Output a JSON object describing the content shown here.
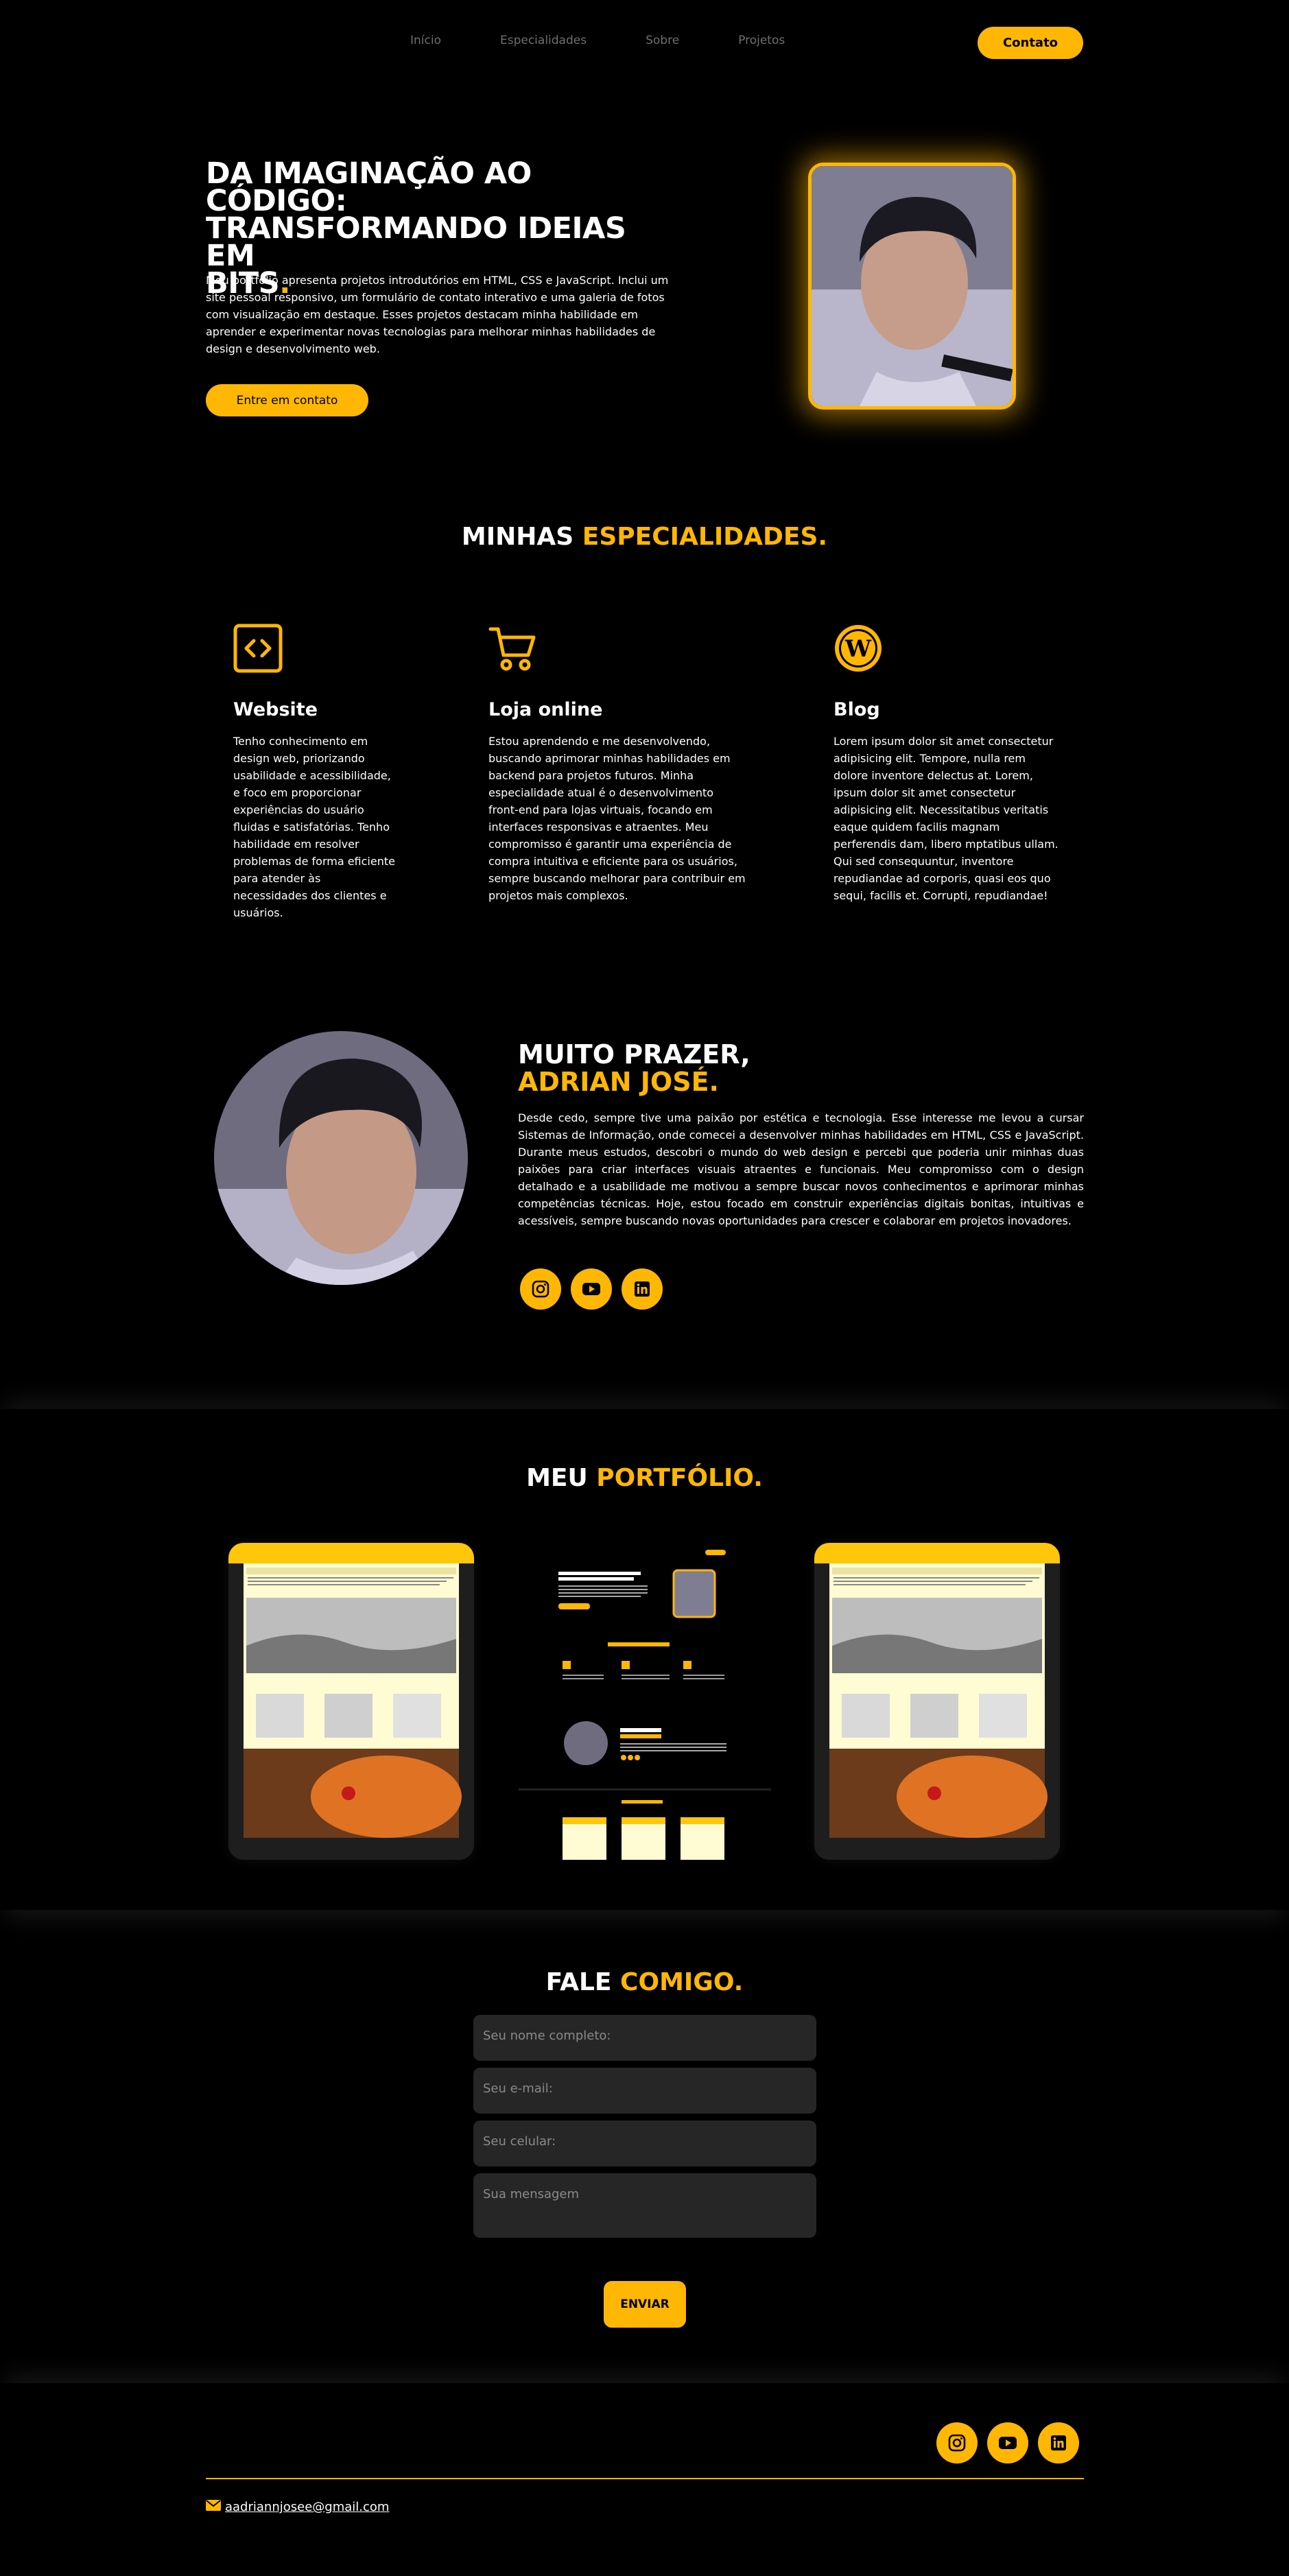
{
  "nav": {
    "links": [
      "Início",
      "Especialidades",
      "Sobre",
      "Projetos"
    ],
    "contact_button": "Contato"
  },
  "hero": {
    "title_line1": "DA IMAGINAÇÃO AO CÓDIGO:",
    "title_line2": "TRANSFORMANDO IDEIAS EM",
    "title_line3": "BITS",
    "title_dot": ".",
    "text": "Meu portfólio apresenta projetos introdutórios em HTML, CSS e JavaScript. Inclui um site pessoal responsivo, um formulário de contato interativo e uma galeria de fotos com visualização em destaque. Esses projetos destacam minha habilidade em aprender e experimentar novas tecnologias para melhorar minhas habilidades de design e desenvolvimento web.",
    "button": "Entre em contato"
  },
  "specialties": {
    "title_white": "MINHAS ",
    "title_yellow": "ESPECIALIDADES.",
    "cards": [
      {
        "icon": "code-icon",
        "title": "Website",
        "text": "Tenho conhecimento em design web, priorizando usabilidade e acessibilidade, e foco em proporcionar experiências do usuário fluidas e satisfatórias. Tenho habilidade em resolver problemas de forma eficiente para atender às necessidades dos clientes e usuários."
      },
      {
        "icon": "shopping-cart-icon",
        "title": "Loja online",
        "text": "Estou aprendendo e me desenvolvendo, buscando aprimorar minhas habilidades em backend para projetos futuros. Minha especialidade atual é o desenvolvimento front-end para lojas virtuais, focando em interfaces responsivas e atraentes. Meu compromisso é garantir uma experiência de compra intuitiva e eficiente para os usuários, sempre buscando melhorar para contribuir em projetos mais complexos."
      },
      {
        "icon": "wordpress-icon",
        "title": "Blog",
        "text": "Lorem ipsum dolor sit amet consectetur adipisicing elit. Tempore, nulla rem dolore inventore delectus at. Lorem, ipsum dolor sit amet consectetur adipisicing elit. Necessitatibus veritatis eaque quidem facilis magnam perferendis dam, libero mptatibus ullam. Qui sed consequuntur, inventore repudiandae ad corporis, quasi eos quo sequi, facilis et. Corrupti, repudiandae!"
      }
    ]
  },
  "about": {
    "title_line1": "MUITO PRAZER,",
    "title_line2": "ADRIAN JOSÉ.",
    "text": "Desde cedo, sempre tive uma paixão por estética e tecnologia. Esse interesse me levou a cursar Sistemas de Informação, onde comecei a desenvolver minhas habilidades em HTML, CSS e JavaScript. Durante meus estudos, descobri o mundo do web design e percebi que poderia unir minhas duas paixões para criar interfaces visuais atraentes e funcionais. Meu compromisso com o design detalhado e a usabilidade me motivou a sempre buscar novos conhecimentos e aprimorar minhas competências técnicas. Hoje, estou focado em construir experiências digitais bonitas, intuitivas e acessíveis, sempre buscando novas oportunidades para crescer e colaborar em projetos inovadores.",
    "socials": [
      "instagram-icon",
      "youtube-icon",
      "linkedin-icon"
    ]
  },
  "portfolio": {
    "title_white": "MEU ",
    "title_yellow": "PORTFÓLIO."
  },
  "contact": {
    "title_white": "FALE ",
    "title_yellow": "COMIGO.",
    "name_placeholder": "Seu nome completo:",
    "email_placeholder": "Seu e-mail:",
    "phone_placeholder": "Seu celular:",
    "message_placeholder": "Sua mensagem",
    "send_button": "ENVIAR"
  },
  "footer": {
    "email": "aadriannjosee@gmail.com",
    "socials": [
      "instagram-icon",
      "youtube-icon",
      "linkedin-icon"
    ]
  },
  "colors": {
    "accent": "#ffb703",
    "background": "#000000",
    "input": "#262626"
  }
}
